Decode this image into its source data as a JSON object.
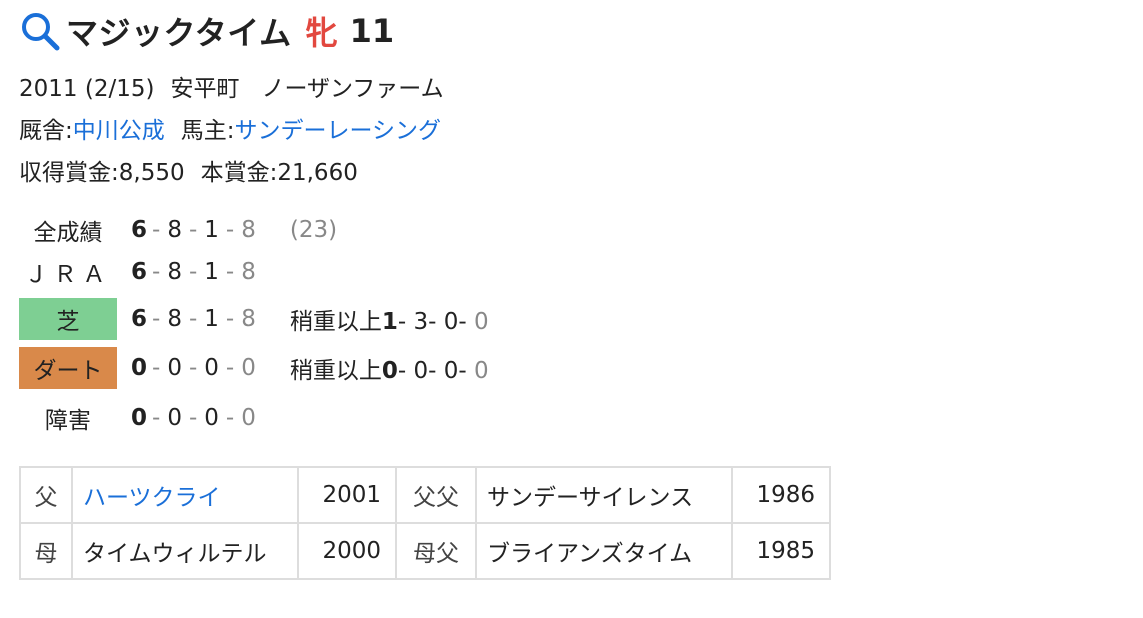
{
  "horse": {
    "name": "マジックタイム",
    "sex": "牝",
    "age": "11",
    "birth": "2011 (2/15)",
    "birthplace": "安平町",
    "breeder": "ノーザンファーム",
    "trainer_label": "厩舎:",
    "trainer": "中川公成",
    "owner_label": "馬主:",
    "owner": "サンデーレーシング",
    "earned_label": "収得賞金:",
    "earned": "8,550",
    "prize_label": "本賞金:",
    "prize": "21,660"
  },
  "records": {
    "all": {
      "label": "全成績",
      "w": "6",
      "s": "8",
      "t": "1",
      "o": "8",
      "extra": "(23)"
    },
    "jra": {
      "label": "ＪＲＡ",
      "w": "6",
      "s": "8",
      "t": "1",
      "o": "8"
    },
    "turf": {
      "label": "芝",
      "w": "6",
      "s": "8",
      "t": "1",
      "o": "8",
      "heavy_label": "稍重以上",
      "hw": "1",
      "hs": "3",
      "ht": "0",
      "ho": "0"
    },
    "dirt": {
      "label": "ダート",
      "w": "0",
      "s": "0",
      "t": "0",
      "o": "0",
      "heavy_label": "稍重以上",
      "hw": "0",
      "hs": "0",
      "ht": "0",
      "ho": "0"
    },
    "obstacle": {
      "label": "障害",
      "w": "0",
      "s": "0",
      "t": "0",
      "o": "0"
    },
    "colors": {
      "turf": "#7ecf93",
      "dirt": "#d9894a",
      "sex": "#e2483f",
      "link": "#1a6fd8"
    }
  },
  "pedigree": {
    "sire": {
      "label": "父",
      "name": "ハーツクライ",
      "year": "2001"
    },
    "sire_sire": {
      "label": "父父",
      "name": "サンデーサイレンス",
      "year": "1986"
    },
    "dam": {
      "label": "母",
      "name": "タイムウィルテル",
      "year": "2000"
    },
    "dam_sire": {
      "label": "母父",
      "name": "ブライアンズタイム",
      "year": "1985"
    }
  },
  "icons": {
    "search": "search-icon"
  }
}
